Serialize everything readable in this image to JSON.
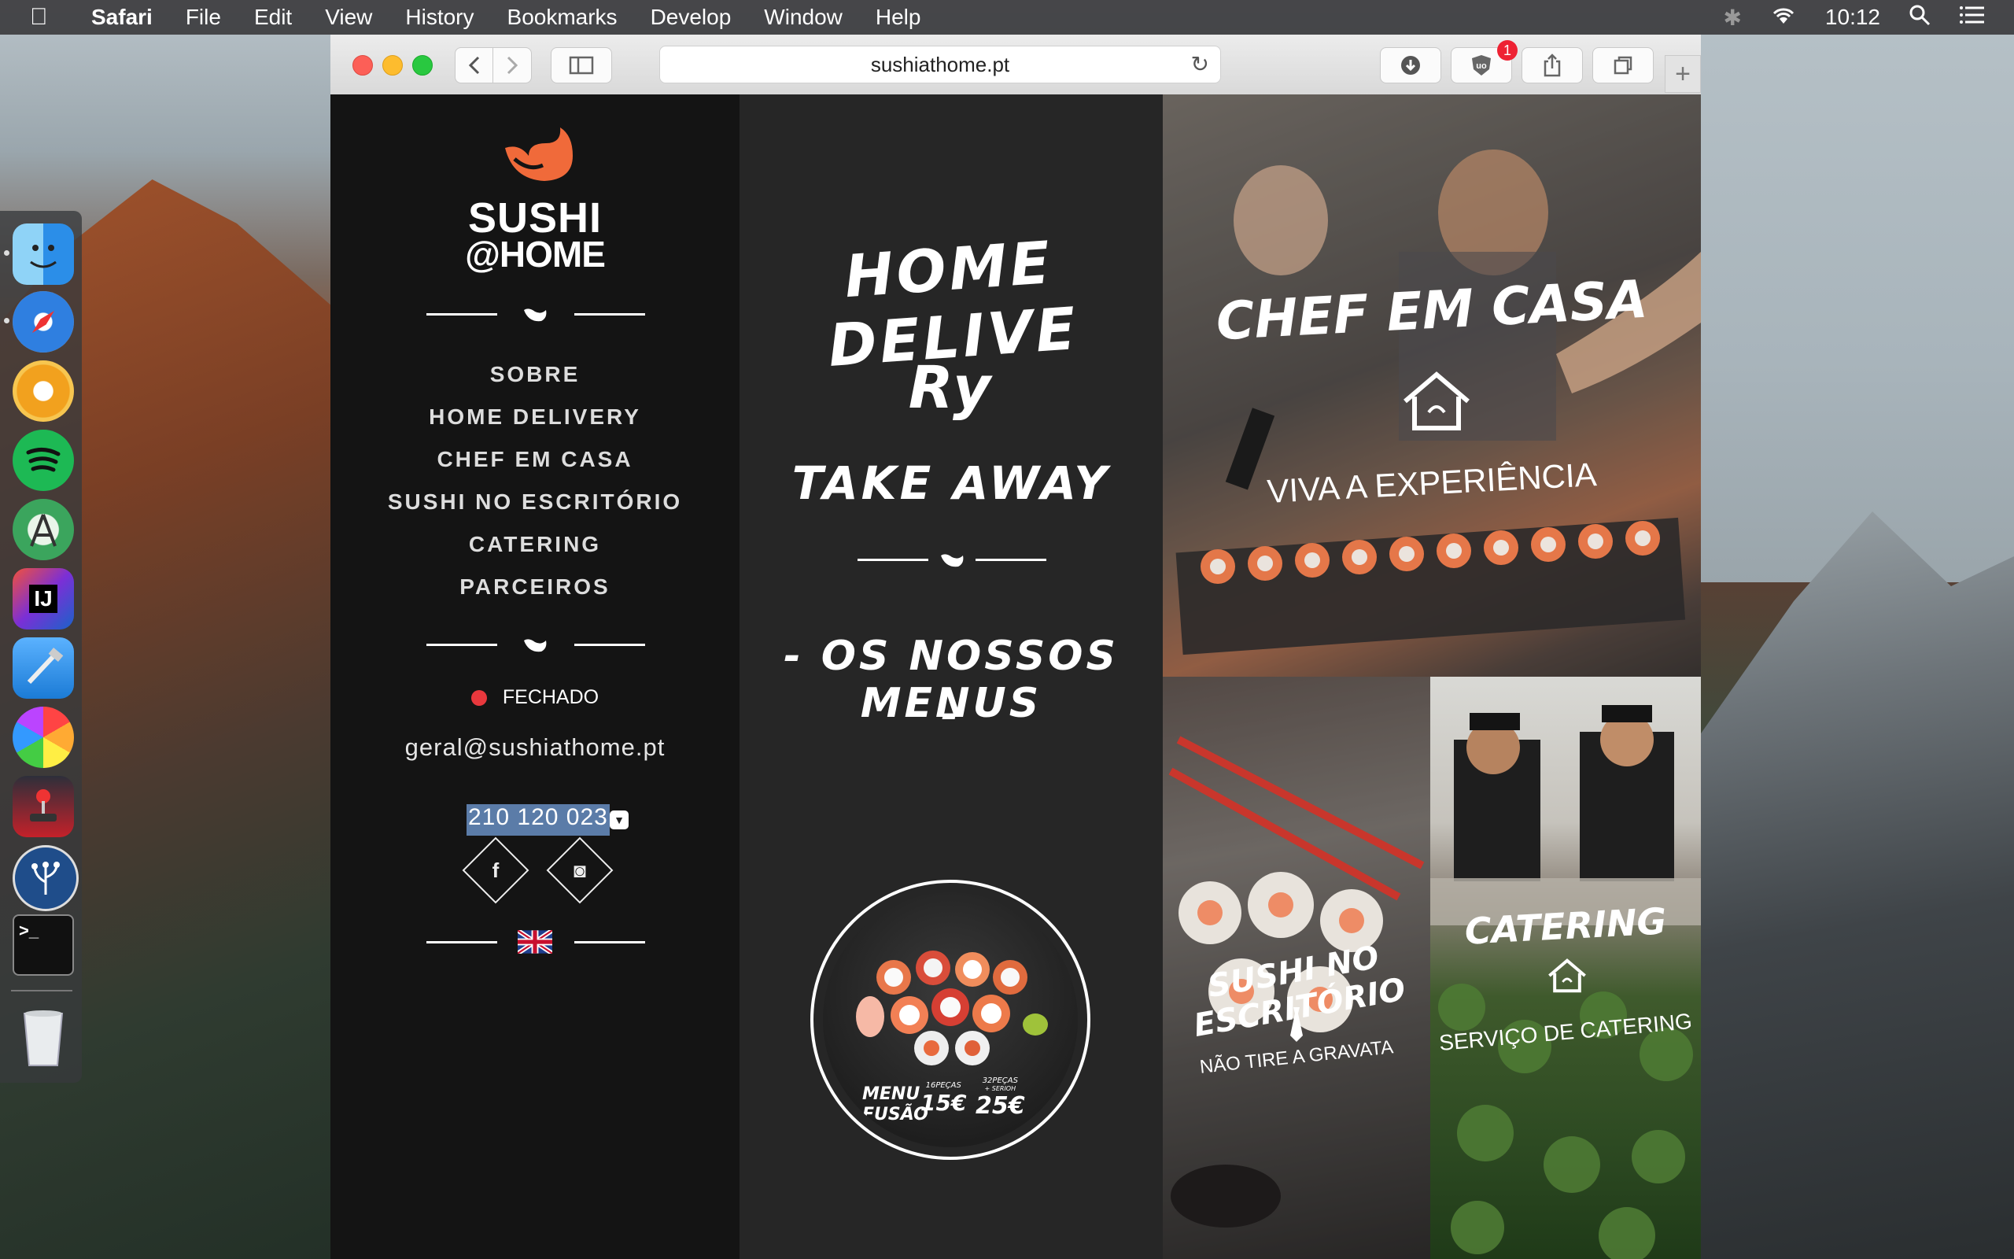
{
  "menubar": {
    "app": "Safari",
    "items": [
      "File",
      "Edit",
      "View",
      "History",
      "Bookmarks",
      "Develop",
      "Window",
      "Help"
    ],
    "clock": "10:12"
  },
  "dock": {
    "apps": [
      {
        "name": "Finder",
        "icon": "finder-icon",
        "color": "#2b8ee8"
      },
      {
        "name": "Safari",
        "icon": "safari-compass-icon",
        "color": "#2f7fe0"
      },
      {
        "name": "Chrome Canary",
        "icon": "chrome-canary-icon",
        "color": "#f2a11e"
      },
      {
        "name": "Spotify",
        "icon": "spotify-icon",
        "color": "#1db954"
      },
      {
        "name": "Android Studio",
        "icon": "android-studio-icon",
        "color": "#3ba55d"
      },
      {
        "name": "IntelliJ IDEA",
        "icon": "intellij-icon",
        "color": "#1a63c9"
      },
      {
        "name": "Xcode",
        "icon": "xcode-icon",
        "color": "#1b7bd6"
      },
      {
        "name": "Color Picker",
        "icon": "color-wheel-icon",
        "color": "#f07a2a"
      },
      {
        "name": "Arcade",
        "icon": "joystick-icon",
        "color": "#c5212a"
      },
      {
        "name": "SourceTree",
        "icon": "sourcetree-icon",
        "color": "#1f4d8a"
      },
      {
        "name": "Terminal",
        "icon": "terminal-icon",
        "color": "#111111"
      },
      {
        "name": "Trash",
        "icon": "trash-icon",
        "color": "#d7dadc"
      }
    ],
    "terminal_glyph": ">_",
    "intellij_glyph": "IJ"
  },
  "browser": {
    "url": "sushiathome.pt",
    "extension_badge": "1",
    "new_tab": "+"
  },
  "site": {
    "logo": {
      "line1": "SUSHI",
      "line2": "@HOME",
      "brand_color": "#f06a3a"
    },
    "nav": [
      "SOBRE",
      "HOME DELIVERY",
      "CHEF EM CASA",
      "SUSHI NO ESCRITÓRIO",
      "CATERING",
      "PARCEIROS"
    ],
    "status": "FECHADO",
    "email": "geral@sushiathome.pt",
    "phone": "210 120 023",
    "social": {
      "facebook": "f",
      "instagram": "◙"
    },
    "delivery": {
      "heading_line1": "HOME DELIVE",
      "heading_line2": "Ry",
      "heading_line3": "TAKE AWAY",
      "menus_label": "- OS NOSSOS MENUS",
      "menus_dash": "-"
    },
    "menu_card": {
      "label_line1": "MENU",
      "label_line2": "FUSÃO",
      "option1_pieces": "16PEÇAS",
      "option1_price": "15€",
      "option2_pieces": "32PEÇAS",
      "option2_price": "25€",
      "option2_note": "+ SERIOH"
    },
    "chef": {
      "title": "CHEF EM CASA",
      "subtitle": "VIVA A EXPERIÊNCIA"
    },
    "office": {
      "title": "SUSHI NO ESCRITÓRIO",
      "subtitle": "NÃO TIRE A GRAVATA"
    },
    "catering": {
      "title": "CATERING",
      "subtitle": "SERVIÇO DE CATERING"
    }
  }
}
